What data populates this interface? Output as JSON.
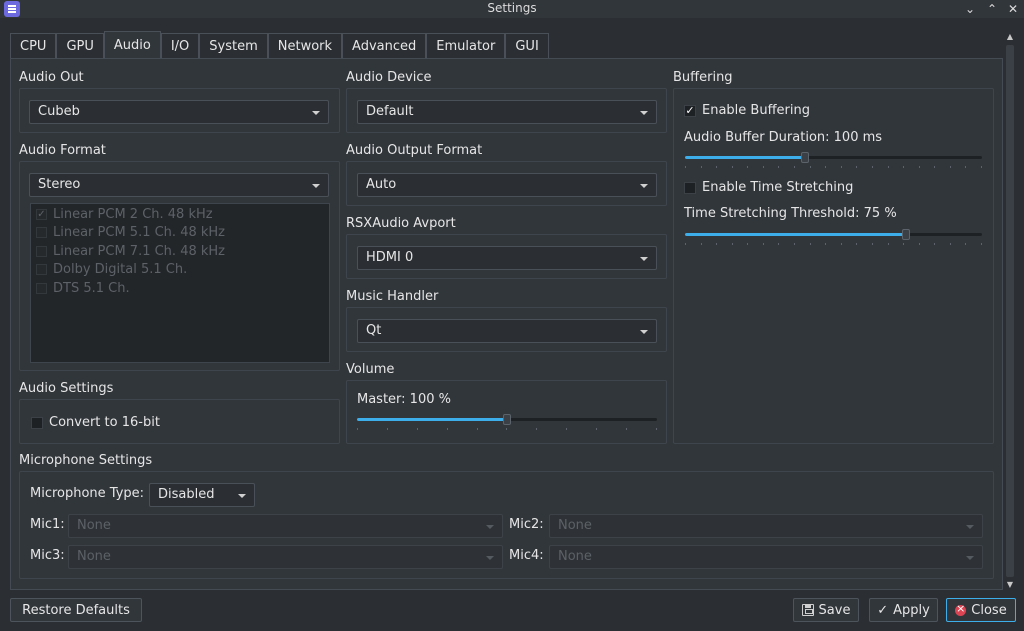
{
  "window": {
    "title": "Settings",
    "minimize_glyph": "⌄",
    "maximize_glyph": "⌃",
    "close_glyph": "✕"
  },
  "tabs": [
    {
      "label": "CPU"
    },
    {
      "label": "GPU"
    },
    {
      "label": "Audio",
      "active": true
    },
    {
      "label": "I/O"
    },
    {
      "label": "System"
    },
    {
      "label": "Network"
    },
    {
      "label": "Advanced"
    },
    {
      "label": "Emulator"
    },
    {
      "label": "GUI"
    }
  ],
  "audio_out": {
    "title": "Audio Out",
    "value": "Cubeb"
  },
  "audio_format": {
    "title": "Audio Format",
    "value": "Stereo",
    "options": [
      {
        "label": "Linear PCM 2 Ch. 48 kHz",
        "checked": true
      },
      {
        "label": "Linear PCM 5.1 Ch. 48 kHz",
        "checked": false
      },
      {
        "label": "Linear PCM 7.1 Ch. 48 kHz",
        "checked": false
      },
      {
        "label": "Dolby Digital 5.1 Ch.",
        "checked": false
      },
      {
        "label": "DTS 5.1 Ch.",
        "checked": false
      }
    ]
  },
  "audio_settings": {
    "title": "Audio Settings",
    "convert_16bit": {
      "label": "Convert to 16-bit",
      "checked": false
    }
  },
  "audio_device": {
    "title": "Audio Device",
    "value": "Default"
  },
  "audio_output_format": {
    "title": "Audio Output Format",
    "value": "Auto"
  },
  "rsxaudio_avport": {
    "title": "RSXAudio Avport",
    "value": "HDMI 0"
  },
  "music_handler": {
    "title": "Music Handler",
    "value": "Qt"
  },
  "volume": {
    "title": "Volume",
    "master_label": "Master: 100 %",
    "master_level": 0.5
  },
  "buffering": {
    "title": "Buffering",
    "enable_buffering": {
      "label": "Enable Buffering",
      "checked": true
    },
    "duration_label": "Audio Buffer Duration: 100 ms",
    "duration_level": 0.4,
    "enable_time_stretching": {
      "label": "Enable Time Stretching",
      "checked": false
    },
    "threshold_label": "Time Stretching Threshold: 75 %",
    "threshold_level": 0.75
  },
  "microphone": {
    "title": "Microphone Settings",
    "type_label": "Microphone Type:",
    "type_value": "Disabled",
    "mic1_label": "Mic1:",
    "mic2_label": "Mic2:",
    "mic3_label": "Mic3:",
    "mic4_label": "Mic4:",
    "mic_value": "None"
  },
  "buttons": {
    "restore_defaults": "Restore Defaults",
    "save": "Save",
    "apply": "Apply",
    "close": "Close",
    "check_glyph": "✓"
  },
  "colors": {
    "accent": "#3daee9",
    "close_red": "#da4453",
    "background": "#31363b"
  },
  "icons": {
    "save": "save-icon",
    "apply": "check-icon",
    "close": "close-circle-icon"
  }
}
